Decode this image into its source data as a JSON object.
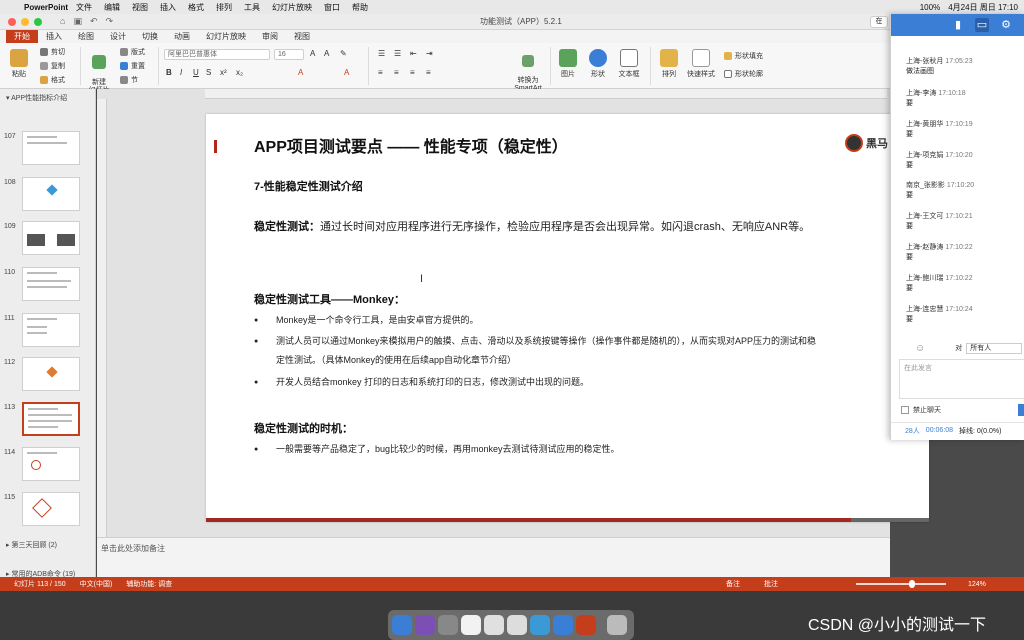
{
  "menubar": {
    "app_name": "PowerPoint",
    "items": [
      "文件",
      "编辑",
      "视图",
      "插入",
      "格式",
      "排列",
      "工具",
      "幻灯片放映",
      "窗口",
      "帮助"
    ],
    "battery": "100%",
    "datetime": "4月24日 周日 17:10",
    "ime": "搜狗拼音"
  },
  "titlebar": {
    "doc_title": "功能测试（APP）5.2.1",
    "search_label": "在"
  },
  "ribbon_tabs": [
    "开始",
    "插入",
    "绘图",
    "设计",
    "切换",
    "动画",
    "幻灯片放映",
    "审阅",
    "视图"
  ],
  "ribbon": {
    "paste": "粘贴",
    "cut": "剪切",
    "copy": "复制",
    "format_painter": "格式",
    "new_slide": "新建\n幻灯片",
    "layout": "版式",
    "reset": "重置",
    "section": "节",
    "font_name": "阿里巴巴普惠体",
    "font_size": "16",
    "convert_smartart": "转换为\nSmartArt",
    "picture": "图片",
    "shape": "形状",
    "textbox": "文本框",
    "arrange": "排列",
    "quick_styles": "快速样式",
    "shape_fill": "形状填充",
    "shape_outline": "形状轮廓"
  },
  "thumbnails": {
    "section_top": "APP性能指标介绍",
    "slides": [
      "107",
      "108",
      "109",
      "110",
      "111",
      "112",
      "113",
      "114",
      "115"
    ],
    "selected": "113",
    "section_3": "第三天回顾 (2)",
    "section_4": "常用的ADB命令 (19)"
  },
  "slide": {
    "title": "APP项目测试要点 —— 性能专项（稳定性）",
    "logo_a": "黑马",
    "logo_b": "程",
    "logo_url": "www.itheim...",
    "heading_1": "7-性能稳定性测试介绍",
    "para_label": "稳定性测试：",
    "para_text": "通过长时间对应用程序进行无序操作，检验应用程序是否会出现异常。如闪退crash、无响应ANR等。",
    "heading_2": "稳定性测试工具——Monkey：",
    "bullets_2": [
      "Monkey是一个命令行工具，是由安卓官方提供的。",
      "测试人员可以通过Monkey来模拟用户的触摸、点击、滑动以及系统按键等操作（操作事件都是随机的），从而实现对APP压力的测试和稳定性测试。（具体Monkey的使用在后续app自动化章节介绍）",
      "开发人员结合monkey 打印的日志和系统打印的日志，修改测试中出现的问题。"
    ],
    "heading_3": "稳定性测试的时机：",
    "bullets_3": [
      "一般需要等产品稳定了，bug比较少的时候，再用monkey去测试待测试应用的稳定性。"
    ]
  },
  "notes_placeholder": "单击此处添加备注",
  "status": {
    "slide_pos": "幻灯片 113 / 150",
    "language": "中文(中国)",
    "accessibility": "辅助功能: 调查",
    "notes": "备注",
    "comments": "批注",
    "zoom": "124%",
    "zoom_level": 0.62
  },
  "chat": {
    "messages": [
      {
        "who": "上海-张秋月",
        "time": "17:05:23",
        "text": "做法画图"
      },
      {
        "who": "上海-李涛",
        "time": "17:10:18",
        "text": "要"
      },
      {
        "who": "上海-黄朋华",
        "time": "17:10:19",
        "text": "要"
      },
      {
        "who": "上海-项克娟",
        "time": "17:10:20",
        "text": "要"
      },
      {
        "who": "南京_张影影",
        "time": "17:10:20",
        "text": "要"
      },
      {
        "who": "上海-王文可",
        "time": "17:10:21",
        "text": "要"
      },
      {
        "who": "上海-赵静涛",
        "time": "17:10:22",
        "text": "要"
      },
      {
        "who": "上海-鲍川瑞",
        "time": "17:10:22",
        "text": "要"
      },
      {
        "who": "上海-连忠慧",
        "time": "17:10:24",
        "text": "要"
      }
    ],
    "to_label": "对",
    "to_value": "所有人",
    "input_placeholder": "在此发言",
    "ban_label": "禁止聊天",
    "people": "28人",
    "elapsed": "00:06:08",
    "lost": "掉线: 0(0.0%)"
  },
  "watermark": "CSDN @小小的测试一下",
  "colors": {
    "accent": "#c43e1c",
    "chat_blue": "#3b7ed6"
  }
}
